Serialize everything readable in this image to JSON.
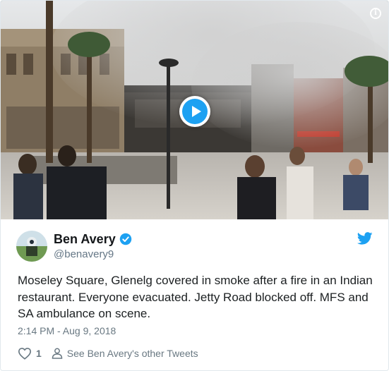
{
  "media": {
    "type": "video",
    "info_icon": "info-icon",
    "play_icon": "play-icon"
  },
  "author": {
    "display_name": "Ben Avery",
    "handle": "@benavery9",
    "verified": true,
    "verified_icon": "verified-badge-icon"
  },
  "brand": {
    "logo": "twitter-bird-icon",
    "accent_color": "#1da1f2"
  },
  "tweet": {
    "text": "Moseley Square, Glenelg covered in smoke after a fire in an Indian restaurant. Everyone evacuated. Jetty Road blocked off. MFS and SA ambulance on scene.",
    "timestamp": "2:14 PM - Aug 9, 2018"
  },
  "actions": {
    "like_icon": "heart-icon",
    "like_count": "1",
    "profile_icon": "person-icon",
    "profile_link_label": "See Ben Avery's other Tweets"
  }
}
